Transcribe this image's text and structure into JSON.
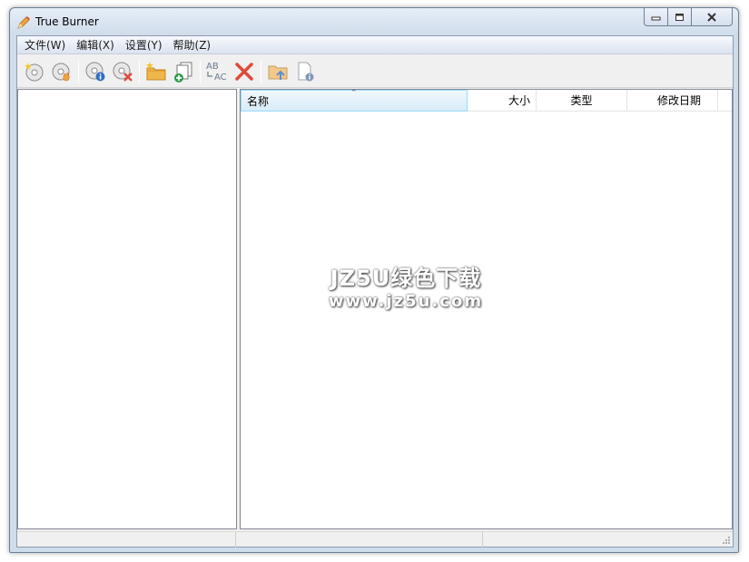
{
  "window": {
    "title": "True Burner"
  },
  "menubar": {
    "items": [
      {
        "label": "文件(W)"
      },
      {
        "label": "编辑(X)"
      },
      {
        "label": "设置(Y)"
      },
      {
        "label": "帮助(Z)"
      }
    ]
  },
  "toolbar": {
    "buttons": [
      {
        "icon": "new-disc-icon"
      },
      {
        "icon": "burn-disc-icon"
      },
      {
        "icon": "disc-info-icon"
      },
      {
        "icon": "erase-disc-icon"
      },
      {
        "icon": "new-folder-icon"
      },
      {
        "icon": "add-files-icon"
      },
      {
        "icon": "rename-icon"
      },
      {
        "icon": "delete-icon"
      },
      {
        "icon": "folder-up-icon"
      },
      {
        "icon": "file-properties-icon"
      }
    ]
  },
  "file_list": {
    "columns": [
      {
        "label": "名称",
        "sorted": "ascending"
      },
      {
        "label": "大小"
      },
      {
        "label": "类型"
      },
      {
        "label": "修改日期"
      }
    ],
    "rows": []
  },
  "watermark": {
    "line1": "JZ5U绿色下载",
    "line2": "www.jz5u.com"
  },
  "statusbar": {
    "panels": [
      "",
      "",
      ""
    ]
  },
  "colors": {
    "title_bar": "#cfdcea",
    "header_highlight": "#d8ecf8",
    "accent_red": "#e04a3a",
    "accent_orange": "#f0a63a"
  }
}
